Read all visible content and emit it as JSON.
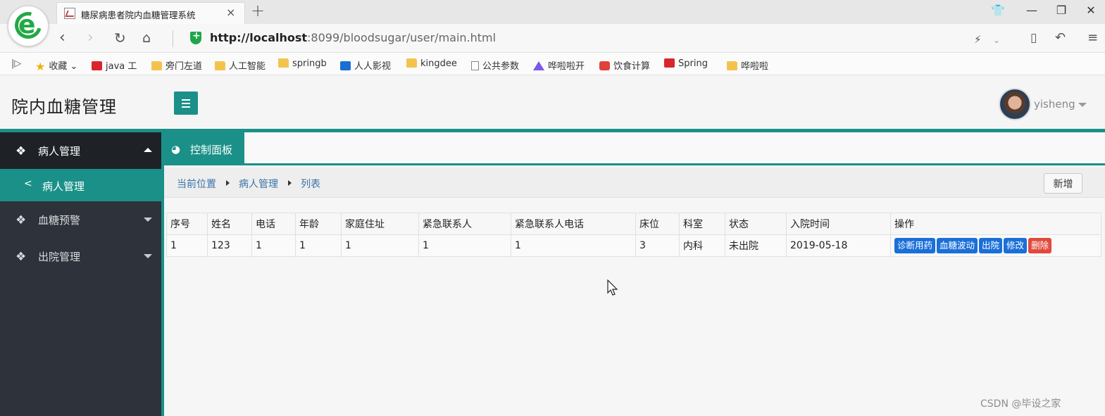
{
  "browser": {
    "tab_title": "糖尿病患者院内血糖管理系统",
    "tab_close": "×",
    "new_tab": "+",
    "url_host": "http://localhost",
    "url_rest": ":8099/bloodsugar/user/main.html",
    "bookmarks": [
      {
        "label": "收藏",
        "icon": "star-icon"
      },
      {
        "label": "java 工",
        "icon": "csdn-icon"
      },
      {
        "label": "旁门左道",
        "icon": "folder-icon"
      },
      {
        "label": "人工智能",
        "icon": "folder-icon"
      },
      {
        "label": "springb",
        "icon": "folder-icon"
      },
      {
        "label": "人人影视",
        "icon": "wave-icon"
      },
      {
        "label": "kingdee",
        "icon": "folder-icon"
      },
      {
        "label": "公共参数",
        "icon": "page-icon"
      },
      {
        "label": "哗啦啦开",
        "icon": "triangle-icon"
      },
      {
        "label": "饮食计算",
        "icon": "cup-icon"
      },
      {
        "label": "Spring",
        "icon": "csdn-icon"
      },
      {
        "label": "哗啦啦",
        "icon": "folder-icon"
      }
    ]
  },
  "app": {
    "title": "院内血糖管理",
    "user_name": "yisheng",
    "accent": "#1a9088"
  },
  "sidebar": {
    "items": [
      {
        "label": "病人管理",
        "expanded": true
      },
      {
        "label": "血糖预警",
        "expanded": false
      },
      {
        "label": "出院管理",
        "expanded": false
      }
    ],
    "sub_item": {
      "label": "病人管理"
    }
  },
  "tabs": {
    "active_label": "控制面板"
  },
  "breadcrumb": {
    "items": [
      "当前位置",
      "病人管理",
      "列表"
    ]
  },
  "toolbar": {
    "add_label": "新增"
  },
  "table": {
    "columns": [
      "序号",
      "姓名",
      "电话",
      "年龄",
      "家庭住址",
      "紧急联系人",
      "紧急联系人电话",
      "床位",
      "科室",
      "状态",
      "入院时间",
      "操作"
    ],
    "rows": [
      {
        "cells": [
          "1",
          "123",
          "1",
          "1",
          "1",
          "1",
          "1",
          "3",
          "内科",
          "未出院",
          "2019-05-18"
        ]
      }
    ],
    "actions": [
      "诊断用药",
      "血糖波动",
      "出院",
      "修改",
      "删除"
    ]
  },
  "watermark": "CSDN @毕设之家"
}
